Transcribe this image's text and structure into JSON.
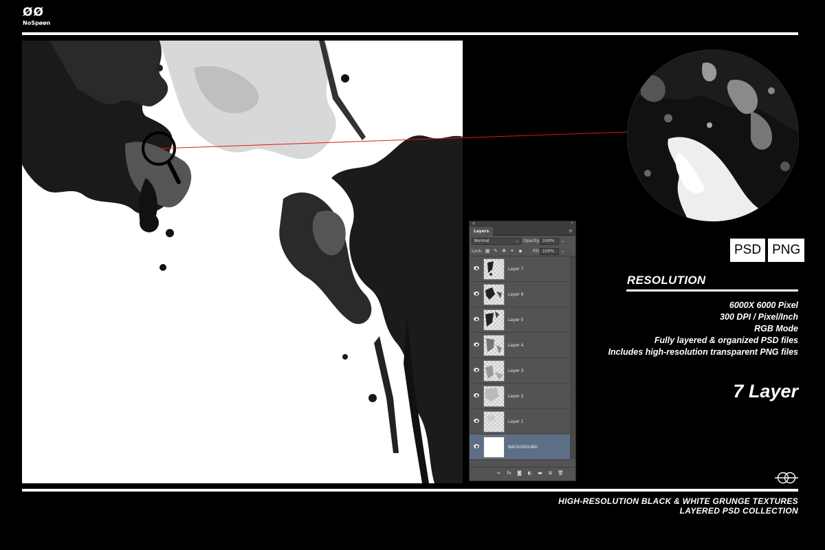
{
  "brand": {
    "mark": "ØØ",
    "name": "NoSpøøn"
  },
  "formats": [
    "PSD",
    "PNG"
  ],
  "resolution": {
    "title": "RESOLUTION",
    "specs": [
      "6000X 6000 Pixel",
      "300 DPI / Pixel/Inch",
      "RGB Mode",
      "Fully layered & organized PSD files",
      "Includes high-resolution transparent PNG files"
    ]
  },
  "layer_count": "7 Layer",
  "tagline": [
    "HIGH-RESOLUTION BLACK & WHITE GRUNGE TEXTURES",
    "LAYERED PSD COLLECTION"
  ],
  "layers_panel": {
    "tab": "Layers",
    "blend_mode": "Normal",
    "opacity_label": "Opacity:",
    "opacity_value": "100%",
    "lock_label": "Lock:",
    "fill_label": "Fill:",
    "fill_value": "100%",
    "layers": [
      {
        "name": "Layer 7",
        "visible": true,
        "selected": false
      },
      {
        "name": "Layer 6",
        "visible": true,
        "selected": false
      },
      {
        "name": "Layer 5",
        "visible": true,
        "selected": false
      },
      {
        "name": "Layer 4",
        "visible": true,
        "selected": false
      },
      {
        "name": "Layer 3",
        "visible": true,
        "selected": false
      },
      {
        "name": "Layer 2",
        "visible": true,
        "selected": false
      },
      {
        "name": "Layer 1",
        "visible": true,
        "selected": false
      },
      {
        "name": "BACKGROUND",
        "visible": true,
        "selected": true
      }
    ],
    "footer_icons": [
      "link-icon",
      "fx-icon",
      "mask-icon",
      "adjustment-icon",
      "folder-icon",
      "new-layer-icon",
      "trash-icon"
    ]
  },
  "colors": {
    "background": "#000000",
    "accent_line": "#e01818",
    "panel": "#535353",
    "selected_layer": "#5c6f86"
  }
}
